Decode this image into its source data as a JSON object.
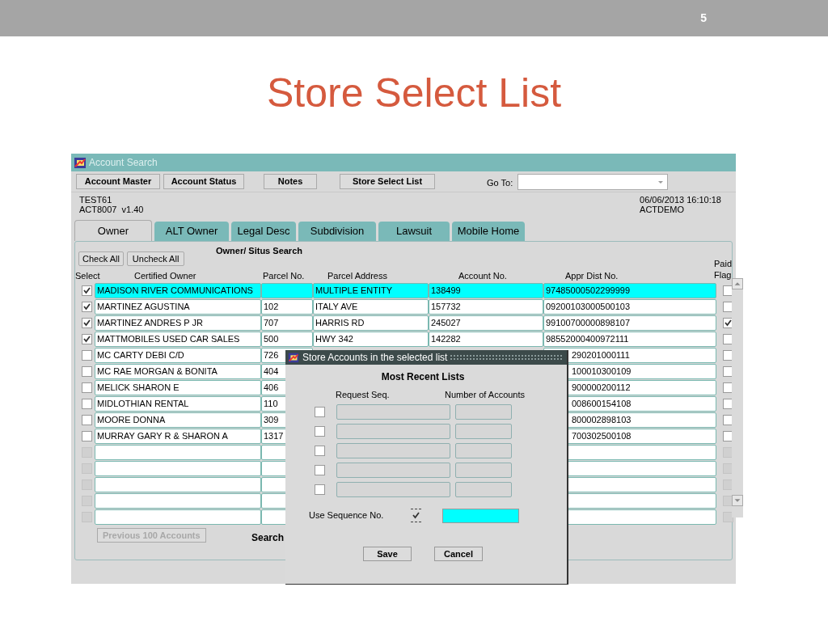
{
  "slide": {
    "page_number": "5",
    "title": "Store Select List"
  },
  "window": {
    "title": "Account Search"
  },
  "toolbar": {
    "buttons": [
      "Account Master",
      "Account Status",
      "Notes",
      "Store Select List"
    ],
    "goto_label": "Go To:"
  },
  "info": {
    "left": [
      "TEST61",
      "ACT8007  v1.40"
    ],
    "right": [
      "06/06/2013 16:10:18",
      "ACTDEMO"
    ]
  },
  "tabs": [
    {
      "label": "Owner",
      "selected": true
    },
    {
      "label": "ALT Owner",
      "selected": false
    },
    {
      "label": "Legal Desc",
      "selected": false
    },
    {
      "label": "Subdivision",
      "selected": false
    },
    {
      "label": "Lawsuit",
      "selected": false
    },
    {
      "label": "Mobile Home",
      "selected": false
    }
  ],
  "panel": {
    "section_title": "Owner/ Situs Search",
    "check_all": "Check All",
    "uncheck_all": "Uncheck  All"
  },
  "columns": [
    "Select",
    "Certified Owner",
    "Parcel No.",
    "Parcel Address",
    "Account No.",
    "Appr Dist No.",
    "Paid Flag"
  ],
  "rows": [
    {
      "kind": "record",
      "checked": true,
      "current": true,
      "owner": "MADISON RIVER COMMUNICATIONS",
      "parcel": "",
      "address": "MULTIPLE ENTITY",
      "account": "138499",
      "appr": "97485000502299999",
      "paid": false
    },
    {
      "kind": "record",
      "checked": true,
      "current": false,
      "owner": "MARTINEZ AGUSTINA",
      "parcel": "102",
      "address": "ITALY AVE",
      "account": "157732",
      "appr": "09200103000500103",
      "paid": false
    },
    {
      "kind": "record",
      "checked": true,
      "current": false,
      "owner": "MARTINEZ ANDRES P JR",
      "parcel": "707",
      "address": "HARRIS RD",
      "account": "245027",
      "appr": "99100700000898107",
      "paid": true
    },
    {
      "kind": "record",
      "checked": true,
      "current": false,
      "owner": "MATTMOBILES USED CAR SALES",
      "parcel": "500",
      "address": "HWY 342",
      "account": "142282",
      "appr": "98552000400972111",
      "paid": false
    },
    {
      "kind": "record",
      "checked": false,
      "current": false,
      "owner": "MC CARTY DEBI C/D",
      "parcel": "726",
      "appr": "290201000111",
      "paid": false
    },
    {
      "kind": "record",
      "checked": false,
      "current": false,
      "owner": "MC RAE MORGAN & BONITA",
      "parcel": "404",
      "appr": "100010300109",
      "paid": false
    },
    {
      "kind": "record",
      "checked": false,
      "current": false,
      "owner": "MELICK SHARON E",
      "parcel": "406",
      "appr": "900000200112",
      "paid": false
    },
    {
      "kind": "record",
      "checked": false,
      "current": false,
      "owner": "MIDLOTHIAN RENTAL",
      "parcel": "110",
      "appr": "008600154108",
      "paid": false
    },
    {
      "kind": "record",
      "checked": false,
      "current": false,
      "owner": "MOORE DONNA",
      "parcel": "309",
      "appr": "800002898103",
      "paid": false
    },
    {
      "kind": "record",
      "checked": false,
      "current": false,
      "owner": "MURRAY GARY R & SHARON A",
      "parcel": "1317",
      "appr": "700302500108",
      "paid": false
    },
    {
      "kind": "empty",
      "disabled": true
    },
    {
      "kind": "empty",
      "disabled": true
    },
    {
      "kind": "empty",
      "disabled": true
    },
    {
      "kind": "empty",
      "disabled": true
    },
    {
      "kind": "empty",
      "disabled": true
    }
  ],
  "footer": {
    "previous": {
      "label": "Previous 100 Accounts",
      "disabled": true
    },
    "search": "Search"
  },
  "dialog": {
    "title": "Store Accounts in the selected list",
    "heading": "Most Recent Lists",
    "columns": [
      "Request Seq.",
      "Number of Accounts"
    ],
    "lists": [
      {
        "checked": false
      },
      {
        "checked": false
      },
      {
        "checked": false
      },
      {
        "checked": false
      },
      {
        "checked": false
      }
    ],
    "use_sequence": {
      "label": "Use Sequence No.",
      "checked": true
    },
    "buttons": [
      "Save",
      "Cancel"
    ]
  }
}
